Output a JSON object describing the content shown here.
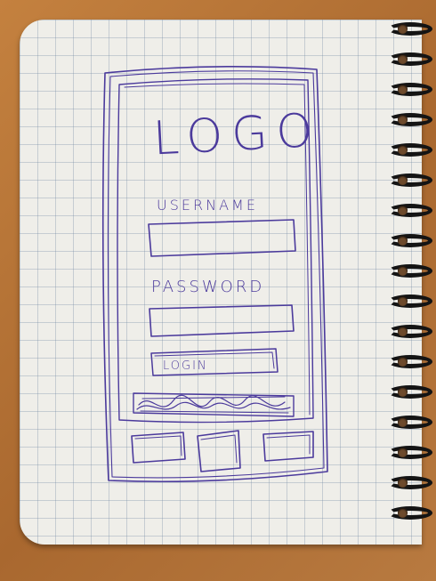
{
  "login_screen": {
    "logo_text": "LOGO",
    "username_label": "USERNAME",
    "password_label": "PASSWORD",
    "login_button_label": "LOGIN"
  },
  "colors": {
    "ink": "#4b3a9c",
    "paper": "#efeee9",
    "desk": "#b8743a"
  },
  "icons": [
    "home-icon",
    "contacts-icon",
    "settings-icon"
  ]
}
